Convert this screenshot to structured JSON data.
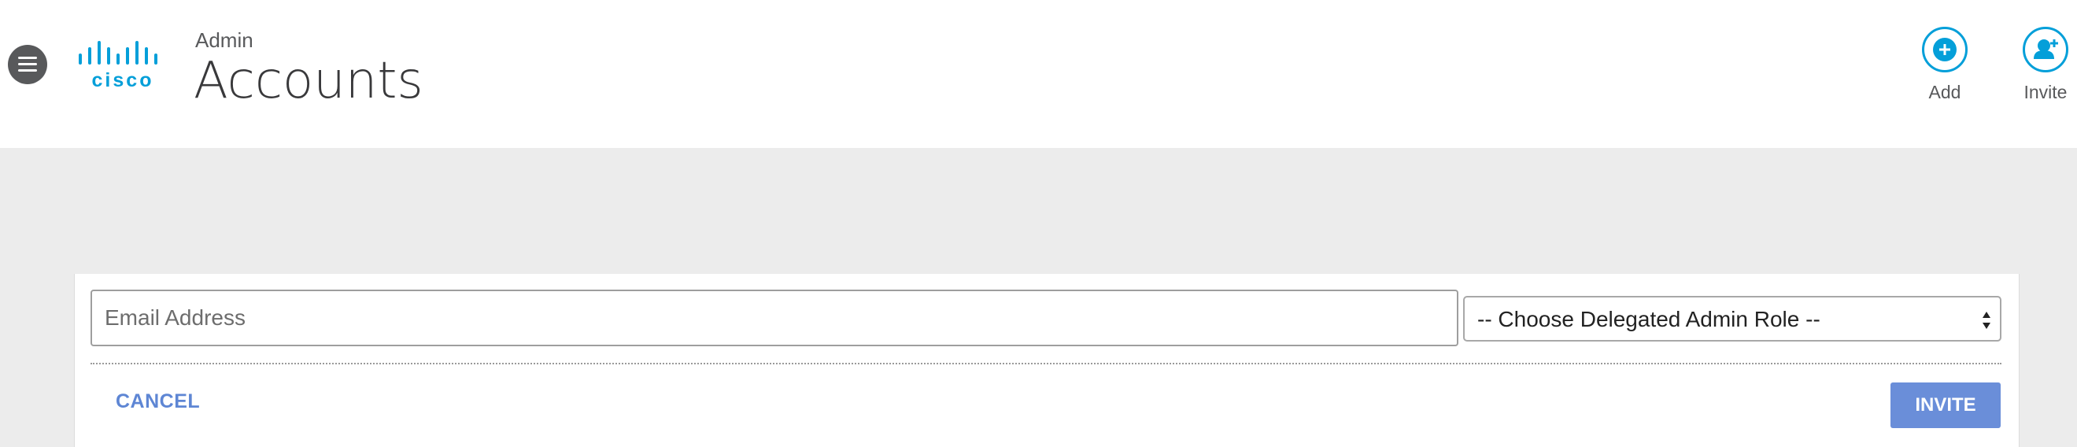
{
  "header": {
    "breadcrumb": "Admin",
    "title": "Accounts",
    "logo_text": "cisco",
    "brand_color": "#049fd9",
    "menu_icon": "hamburger-menu-icon"
  },
  "actions": {
    "add_label": "Add",
    "add_icon": "plus-circle-icon",
    "invite_label": "Invite",
    "invite_icon": "person-add-icon"
  },
  "invite_form": {
    "email_placeholder": "Email Address",
    "email_value": "",
    "role_selected": "-- Choose Delegated Admin Role --",
    "cancel_label": "CANCEL",
    "submit_label": "INVITE",
    "accent_color": "#6a8ed9"
  }
}
